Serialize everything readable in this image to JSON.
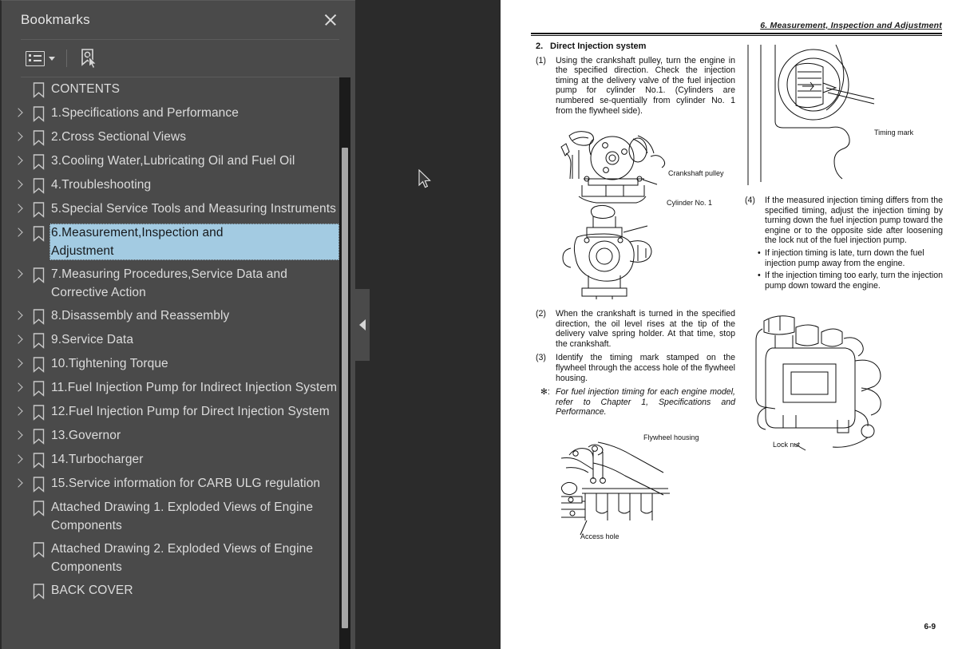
{
  "panel": {
    "title": "Bookmarks",
    "close_icon": "close-icon",
    "toolbar": {
      "list_options_icon": "list-options-icon",
      "list_options_caret": "chevron-down-icon",
      "find_bookmark_icon": "bookmark-cursor-icon"
    },
    "items": [
      {
        "label": "CONTENTS",
        "expandable": false,
        "selected": false
      },
      {
        "label": "1.Specifications and Performance",
        "expandable": true,
        "selected": false
      },
      {
        "label": "2.Cross Sectional Views",
        "expandable": true,
        "selected": false
      },
      {
        "label": "3.Cooling Water,Lubricating Oil and Fuel Oil",
        "expandable": true,
        "selected": false
      },
      {
        "label": "4.Troubleshooting",
        "expandable": true,
        "selected": false
      },
      {
        "label": "5.Special Service Tools and Measuring Instruments",
        "expandable": true,
        "selected": false
      },
      {
        "label": "6.Measurement,Inspection and Adjustment",
        "expandable": true,
        "selected": true
      },
      {
        "label": "7.Measuring Procedures,Service Data and\nCorrective Action",
        "expandable": true,
        "selected": false
      },
      {
        "label": "8.Disassembly and Reassembly",
        "expandable": true,
        "selected": false
      },
      {
        "label": "9.Service Data",
        "expandable": true,
        "selected": false
      },
      {
        "label": "10.Tightening Torque",
        "expandable": true,
        "selected": false
      },
      {
        "label": "11.Fuel Injection Pump for Indirect Injection System",
        "expandable": true,
        "selected": false
      },
      {
        "label": "12.Fuel Injection Pump for Direct Injection System",
        "expandable": true,
        "selected": false
      },
      {
        "label": "13.Governor",
        "expandable": true,
        "selected": false
      },
      {
        "label": "14.Turbocharger",
        "expandable": true,
        "selected": false
      },
      {
        "label": "15.Service information for CARB ULG regulation",
        "expandable": true,
        "selected": false
      },
      {
        "label": "Attached Drawing 1. Exploded Views of Engine\nComponents",
        "expandable": false,
        "selected": false
      },
      {
        "label": "Attached Drawing 2. Exploded Views of Engine\nComponents",
        "expandable": false,
        "selected": false
      },
      {
        "label": "BACK COVER",
        "expandable": false,
        "selected": false
      }
    ],
    "scrollbar": {
      "name": "vertical-scrollbar"
    }
  },
  "viewer": {
    "collapse_handle_icon": "chevron-left-icon",
    "cursor_icon": "mouse-pointer"
  },
  "document": {
    "running_header": "6. Measurement, Inspection and Adjustment",
    "page_number": "6-9",
    "section": {
      "number": "2.",
      "title": "Direct Injection system"
    },
    "steps": [
      {
        "marker": "(1)",
        "text": "Using the crankshaft pulley, turn the engine in the specified direction.  Check the injection timing at the delivery valve of the fuel injection pump for cylinder No.1. (Cylinders are numbered se-quentially from cylinder No. 1 from the flywheel side)."
      },
      {
        "marker": "(2)",
        "text": "When the crankshaft is turned in the specified direction, the oil level rises at the tip of the delivery valve spring holder. At that time, stop the crankshaft."
      },
      {
        "marker": "(3)",
        "text": "Identify the timing mark stamped on the flywheel through the access hole of the flywheel housing."
      }
    ],
    "note": {
      "marker": "✻:",
      "text": "For fuel injection timing for each engine model, refer to Chapter 1, Specifications and Performance."
    },
    "step4": {
      "marker": "(4)",
      "text": "If the measured injection timing differs from the specified timing, adjust the injection timing by turning down the fuel injection pump toward the engine or to the opposite side after loosening the lock nut of the fuel injection pump.",
      "bullets": [
        "If injection timing is late, turn down the fuel injection pump away from the engine.",
        "If the injection timing too early, turn the injection pump down toward the engine."
      ]
    },
    "figure_captions": {
      "crankshaft_pulley": "Crankshaft pulley",
      "cylinder_no1": "Cylinder No. 1",
      "flywheel_housing": "Flywheel housing",
      "access_hole": "Access hole",
      "timing_mark": "Timing mark",
      "lock_nut": "Lock nut"
    }
  },
  "colors": {
    "panel_bg": "#4a4a4a",
    "viewer_bg": "#2b2b2b",
    "selection": "#a3cbe2",
    "text": "#dcdcdc",
    "page_bg": "#ffffff"
  }
}
